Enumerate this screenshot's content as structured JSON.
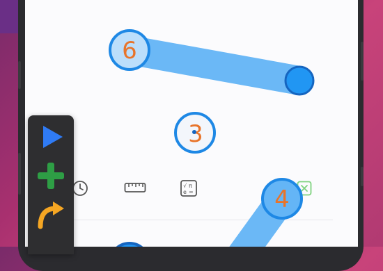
{
  "colors": {
    "accent_blue": "#2196f3",
    "segment_blue": "#64b5f6",
    "number_orange": "#e8742a",
    "play_blue": "#2f7bf5",
    "plus_green": "#2e9e45",
    "arrow_orange": "#f5a623",
    "delete_green": "#7ed27e"
  },
  "icons": {
    "toolbar": [
      "clock-icon",
      "ruler-icon",
      "formula-icon",
      "delete-icon"
    ],
    "floating": [
      "play-icon",
      "plus-icon",
      "redo-arrow-icon"
    ]
  },
  "points": {
    "p6": {
      "label": "6"
    },
    "p3": {
      "label": "3"
    },
    "p4": {
      "label": "4"
    }
  }
}
